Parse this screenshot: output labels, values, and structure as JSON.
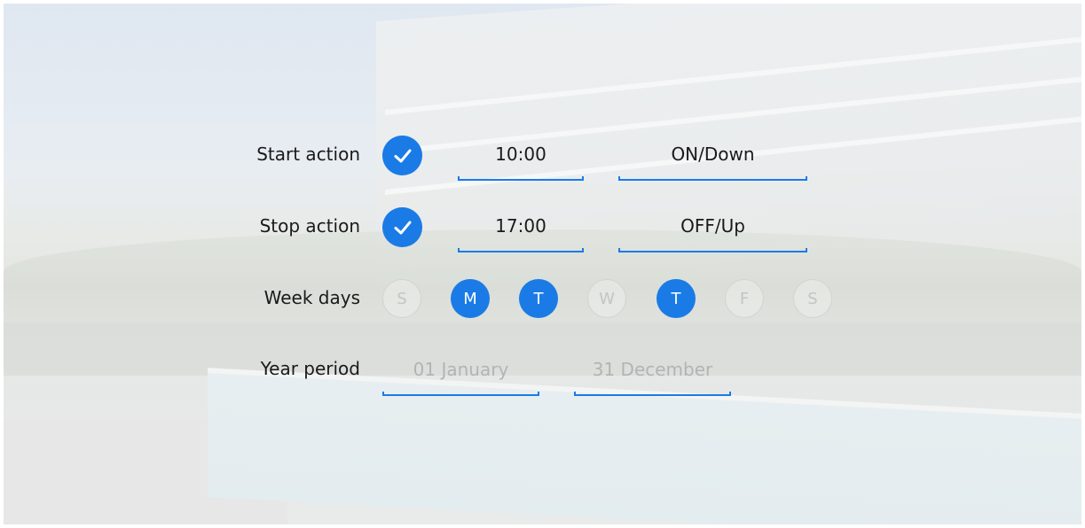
{
  "accent_color": "#1a7be6",
  "start_action": {
    "label": "Start action",
    "enabled": true,
    "time": "10:00",
    "action": "ON/Down"
  },
  "stop_action": {
    "label": "Stop action",
    "enabled": true,
    "time": "17:00",
    "action": "OFF/Up"
  },
  "week_days": {
    "label": "Week days",
    "days": [
      {
        "letter": "S",
        "selected": false
      },
      {
        "letter": "M",
        "selected": true
      },
      {
        "letter": "T",
        "selected": true
      },
      {
        "letter": "W",
        "selected": false
      },
      {
        "letter": "T",
        "selected": true
      },
      {
        "letter": "F",
        "selected": false
      },
      {
        "letter": "S",
        "selected": false
      }
    ]
  },
  "year_period": {
    "label": "Year period",
    "from": "01 January",
    "to": "31 December"
  }
}
